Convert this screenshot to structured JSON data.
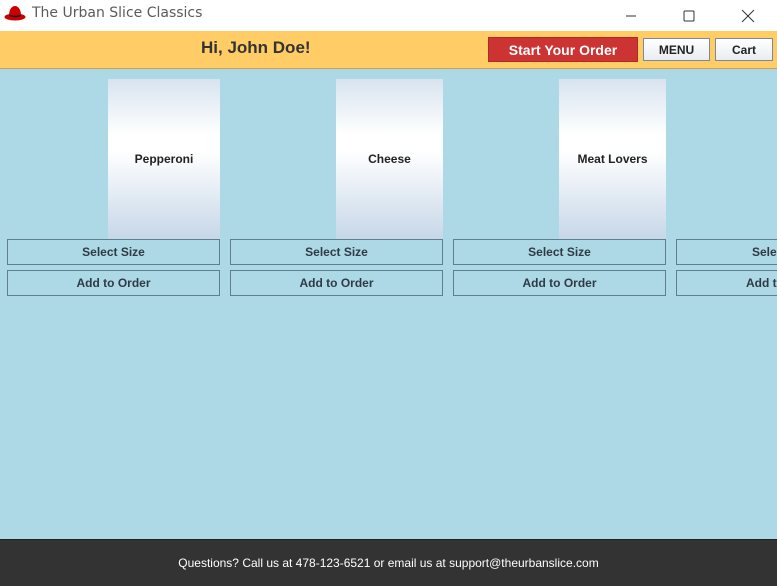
{
  "window": {
    "title": "The Urban Slice Classics",
    "icon": "red-hat-icon"
  },
  "header": {
    "greeting": "Hi, John Doe!",
    "start_order_label": "Start Your Order",
    "menu_label": "MENU",
    "cart_label": "Cart",
    "background": "#ffcc66",
    "accent": "#cc3333"
  },
  "main": {
    "background": "#add8e6",
    "items": [
      {
        "name": "Pepperoni",
        "size_label": "Select Size",
        "add_label": "Add to Order"
      },
      {
        "name": "Cheese",
        "size_label": "Select Size",
        "add_label": "Add to Order"
      },
      {
        "name": "Meat Lovers",
        "size_label": "Select Size",
        "add_label": "Add to Order"
      },
      {
        "name": "",
        "size_label": "Sele",
        "add_label": "Add t"
      }
    ]
  },
  "footer": {
    "text": "Questions? Call us at  478-123-6521 or email us at support@theurbanslice.com"
  }
}
